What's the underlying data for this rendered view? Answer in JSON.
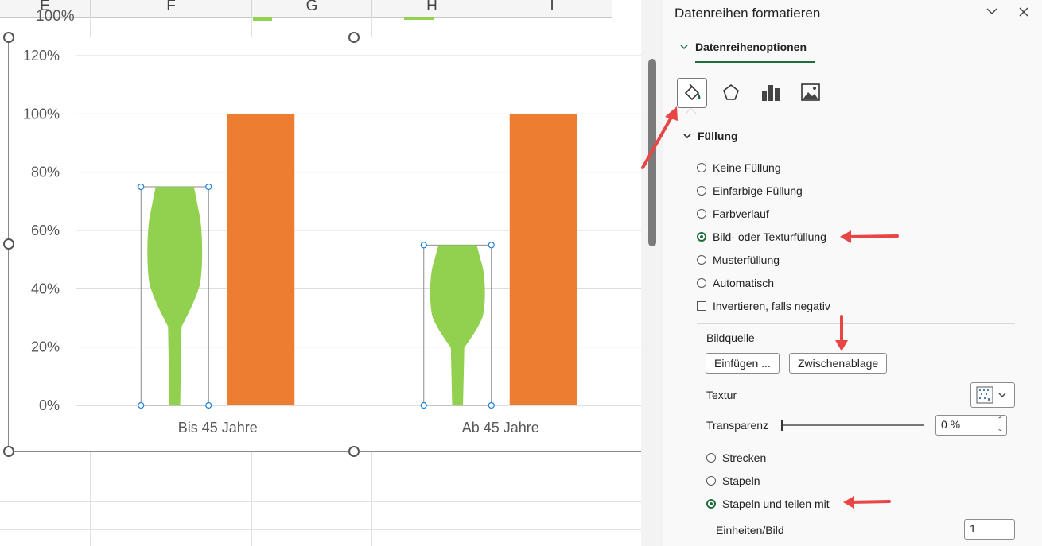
{
  "sheet": {
    "columns": [
      "E",
      "F",
      "G",
      "H",
      "I"
    ],
    "partial_top_text": "100%"
  },
  "chart_data": {
    "type": "bar",
    "categories": [
      "Bis 45 Jahre",
      "Ab 45 Jahre"
    ],
    "series": [
      {
        "values": [
          75,
          55
        ],
        "color": "#92d050",
        "fill": "picture-tree"
      },
      {
        "values": [
          100,
          100
        ],
        "color": "#ed7d31"
      }
    ],
    "y_ticks": [
      "0%",
      "20%",
      "40%",
      "60%",
      "80%",
      "100%",
      "120%"
    ],
    "ylim": [
      0,
      120
    ],
    "grid": true
  },
  "pane": {
    "title": "Datenreihen formatieren",
    "options_tab": "Datenreihenoptionen",
    "section_fill": "Füllung",
    "fill_options": [
      "Keine Füllung",
      "Einfarbige Füllung",
      "Farbverlauf",
      "Bild- oder Texturfüllung",
      "Musterfüllung",
      "Automatisch"
    ],
    "selected_fill": "Bild- oder Texturfüllung",
    "invert_label": "Invertieren, falls negativ",
    "bildquelle_label": "Bildquelle",
    "btn_insert": "Einfügen ...",
    "btn_clipboard": "Zwischenablage",
    "textur_label": "Textur",
    "transparenz_label": "Transparenz",
    "transparenz_value": "0 %",
    "stretch_options": [
      "Strecken",
      "Stapeln",
      "Stapeln und teilen mit"
    ],
    "selected_stretch": "Stapeln und teilen mit",
    "units_label": "Einheiten/Bild",
    "units_value": "1"
  },
  "colors": {
    "accent": "#1e6f3c",
    "arrow": "#e84545",
    "green": "#92d050",
    "orange": "#ed7d31"
  }
}
